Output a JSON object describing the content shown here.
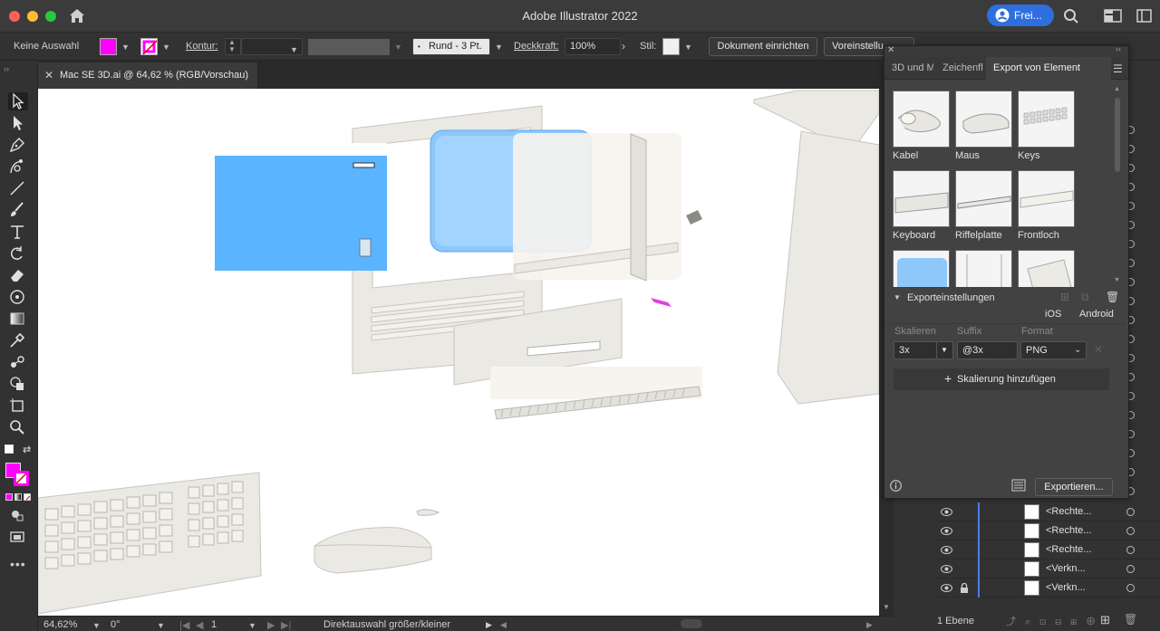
{
  "window": {
    "title": "Adobe Illustrator 2022",
    "share_label": "Frei...",
    "traffic_colors": [
      "#fe5f57",
      "#febc2e",
      "#28c840"
    ]
  },
  "controlbar": {
    "selection": "Keine Auswahl",
    "fill_color": "#ff00ff",
    "stroke_label": "Kontur:",
    "brush_label": "Rund - 3 Pt.",
    "opacity_label": "Deckkraft:",
    "opacity_value": "100%",
    "style_label": "Stil:",
    "doc_setup_button": "Dokument einrichten",
    "preferences_button": "Voreinstellu"
  },
  "document": {
    "tab_label": "Mac SE 3D.ai @ 64,62 % (RGB/Vorschau)"
  },
  "statusbar": {
    "zoom": "64,62%",
    "rotation": "0°",
    "artboard": "1",
    "tool_hint": "Direktauswahl größer/kleiner"
  },
  "export_panel": {
    "tabs": [
      "3D und M",
      "Zeichenfl",
      "Export von Element"
    ],
    "active_tab": "Export von Element",
    "assets": [
      {
        "label": "Kabel",
        "icon": "cable-thumbnail"
      },
      {
        "label": "Maus",
        "icon": "mouse-thumbnail"
      },
      {
        "label": "Keys",
        "icon": "keys-thumbnail"
      },
      {
        "label": "Keyboard",
        "icon": "keyboard-thumbnail"
      },
      {
        "label": "Riffelplatte",
        "icon": "grill-thumbnail"
      },
      {
        "label": "Frontloch",
        "icon": "frontslot-thumbnail"
      },
      {
        "label": "",
        "icon": "screen-thumbnail"
      },
      {
        "label": "",
        "icon": "box-thumbnail"
      },
      {
        "label": "",
        "icon": "case-thumbnail"
      }
    ],
    "settings_title": "Exporteinstellungen",
    "presets": [
      "iOS",
      "Android"
    ],
    "col_scale": "Skalieren",
    "col_suffix": "Suffix",
    "col_format": "Format",
    "scale_value": "3x",
    "suffix_value": "@3x",
    "format_value": "PNG",
    "add_scale_button": "Skalierung hinzufügen",
    "export_button": "Exportieren..."
  },
  "layers": {
    "rows": [
      {
        "name": "<Rechte...",
        "locked": false
      },
      {
        "name": "<Rechte...",
        "locked": false
      },
      {
        "name": "<Rechte...",
        "locked": false
      },
      {
        "name": "<Verkn...",
        "locked": false
      },
      {
        "name": "<Verkn...",
        "locked": true
      }
    ],
    "footer": "1 Ebene"
  },
  "colors": {
    "accent_blue": "#2e6fdd",
    "screen_blue": "#5ab4ff",
    "magenta": "#ff00ff"
  }
}
